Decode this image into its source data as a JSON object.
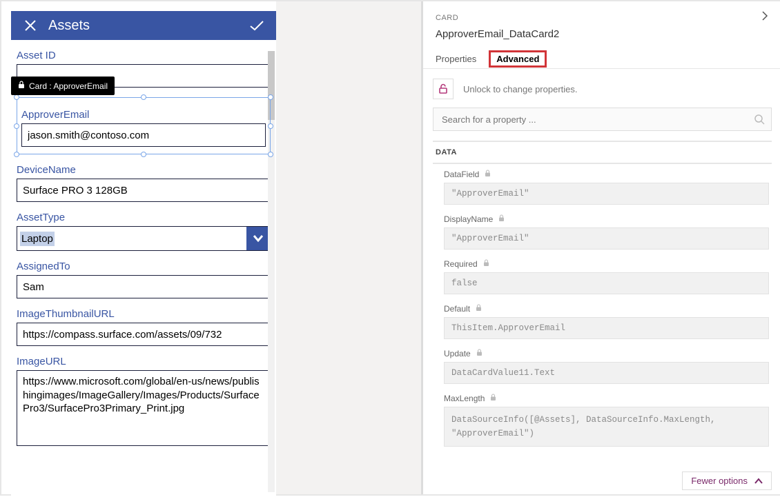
{
  "form": {
    "title": "Assets",
    "selectedTooltip": "Card : ApproverEmail",
    "fields": {
      "assetId": {
        "label": "Asset ID",
        "value": ""
      },
      "approverEmail": {
        "label": "ApproverEmail",
        "value": "jason.smith@contoso.com"
      },
      "deviceName": {
        "label": "DeviceName",
        "value": "Surface PRO 3 128GB"
      },
      "assetType": {
        "label": "AssetType",
        "value": "Laptop"
      },
      "assignedTo": {
        "label": "AssignedTo",
        "value": "Sam"
      },
      "imageThumb": {
        "label": "ImageThumbnailURL",
        "value": "https://compass.surface.com/assets/09/732"
      },
      "imageUrl": {
        "label": "ImageURL",
        "value": "https://www.microsoft.com/global/en-us/news/publishingimages/ImageGallery/Images/Products/SurfacePro3/SurfacePro3Primary_Print.jpg"
      }
    }
  },
  "panel": {
    "kind": "CARD",
    "name": "ApproverEmail_DataCard2",
    "tabs": {
      "properties": "Properties",
      "advanced": "Advanced"
    },
    "unlockText": "Unlock to change properties.",
    "searchPlaceholder": "Search for a property ...",
    "section": "DATA",
    "props": {
      "dataField": {
        "label": "DataField",
        "value": "\"ApproverEmail\""
      },
      "displayName": {
        "label": "DisplayName",
        "value": "\"ApproverEmail\""
      },
      "required": {
        "label": "Required",
        "value": "false"
      },
      "default": {
        "label": "Default",
        "value": "ThisItem.ApproverEmail"
      },
      "update": {
        "label": "Update",
        "value": "DataCardValue11.Text"
      },
      "maxLength": {
        "label": "MaxLength",
        "value": "DataSourceInfo([@Assets], DataSourceInfo.MaxLength, \"ApproverEmail\")"
      }
    },
    "fewer": "Fewer options"
  }
}
